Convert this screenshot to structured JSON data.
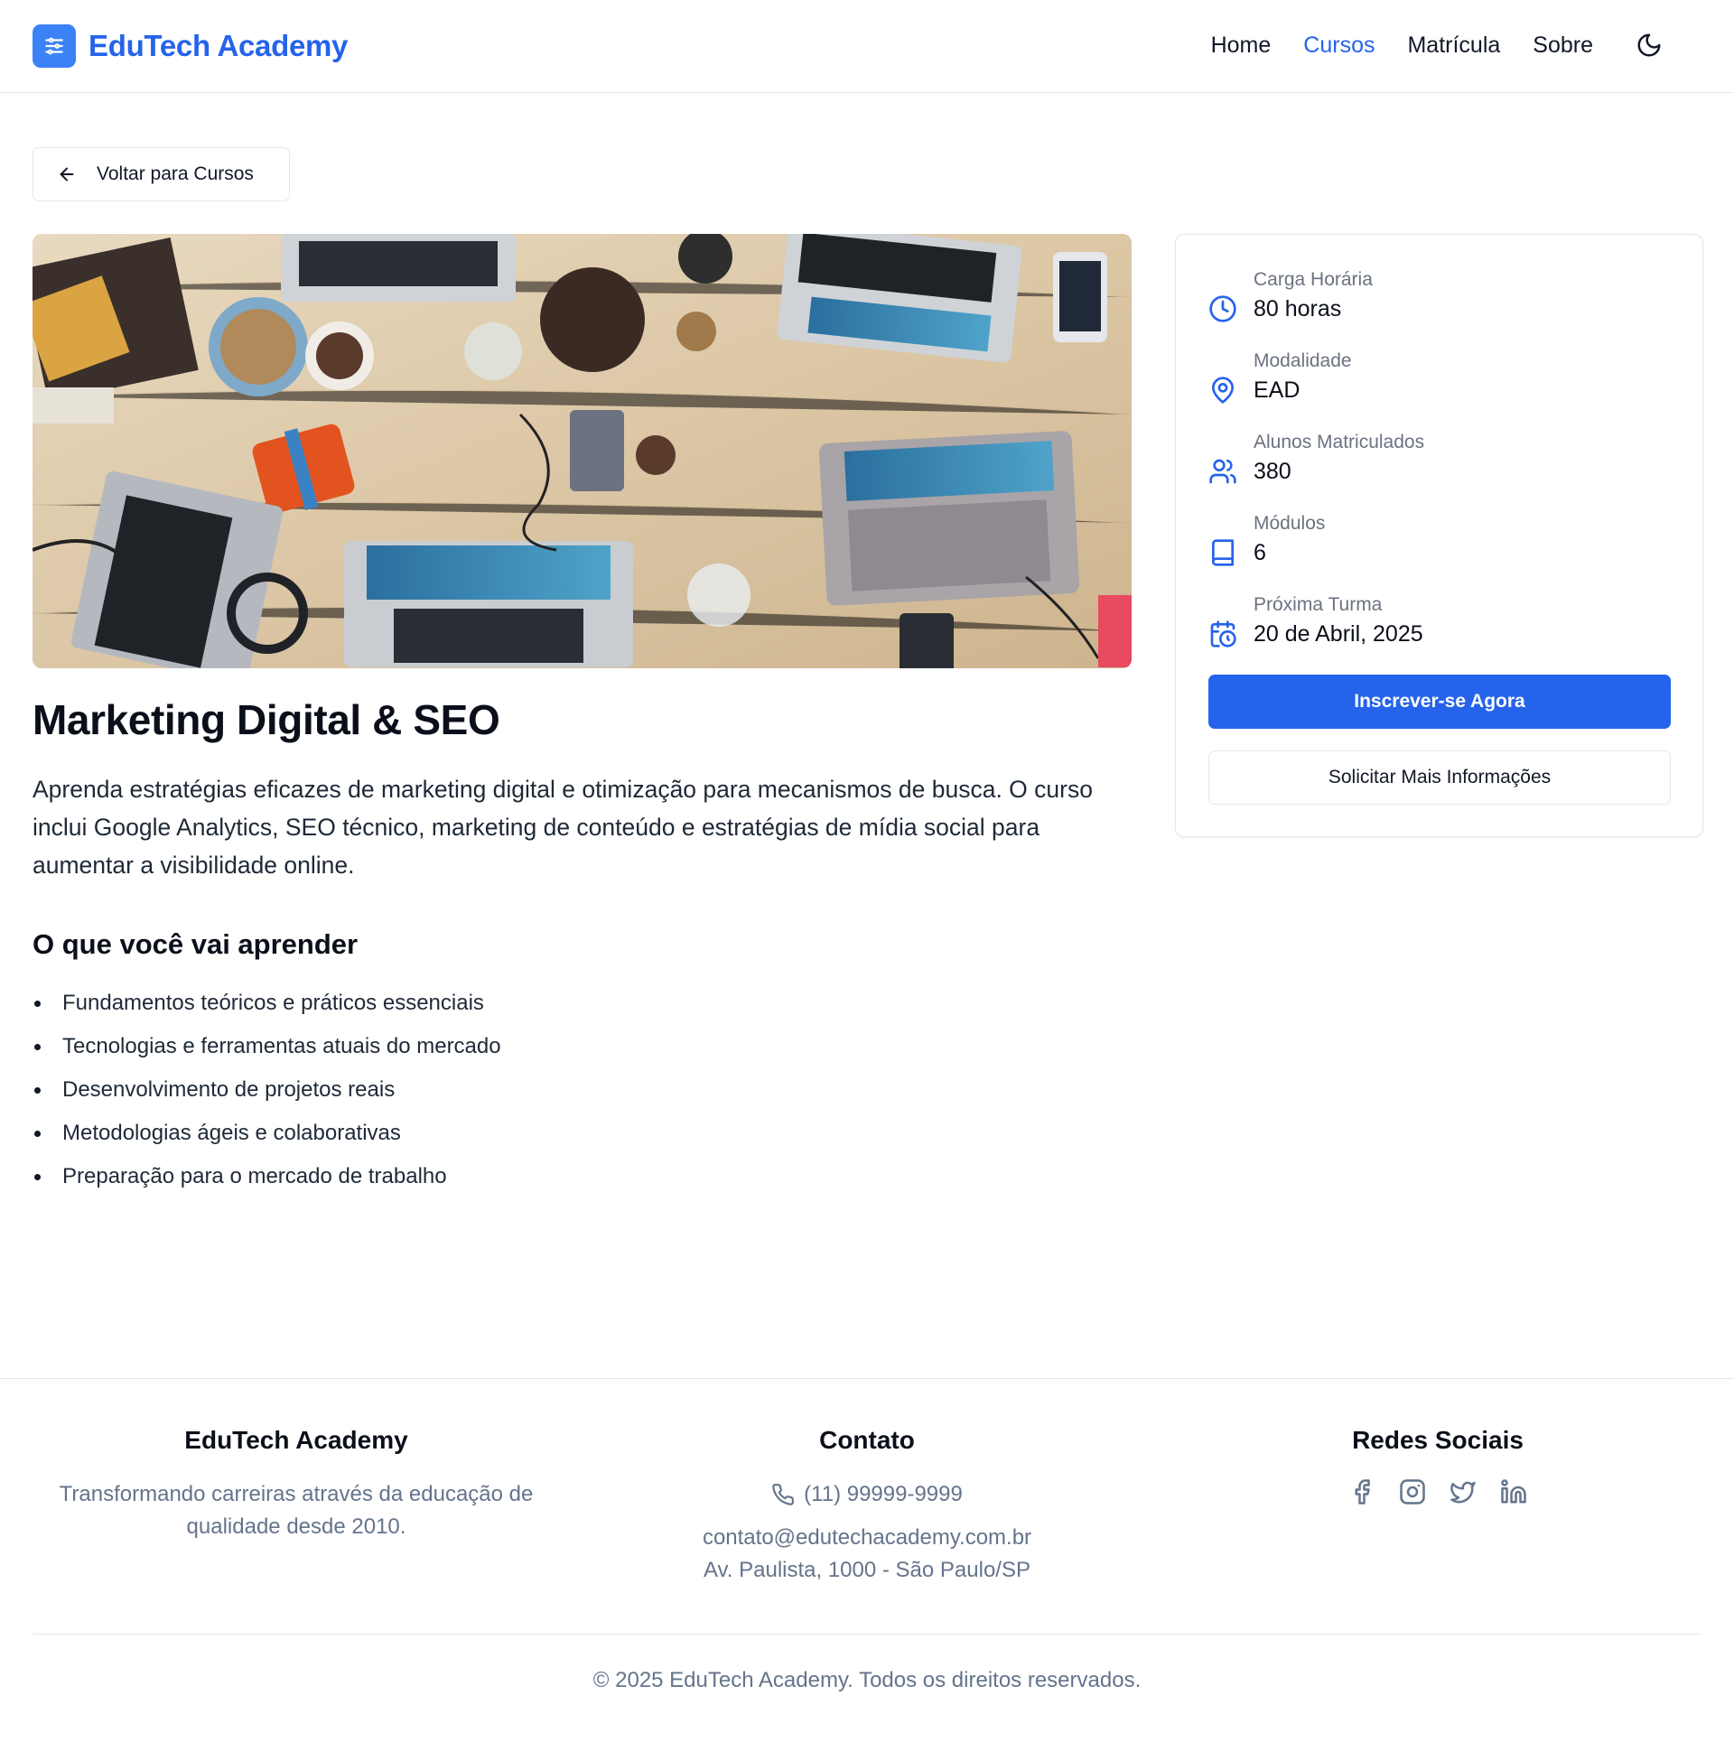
{
  "header": {
    "logo_text": "EduTech Academy",
    "nav": [
      "Home",
      "Cursos",
      "Matrícula",
      "Sobre"
    ],
    "active_nav": "Cursos"
  },
  "back_button": {
    "label": "Voltar para Cursos",
    "icon": "arrow-left-icon"
  },
  "course": {
    "title": "Marketing Digital & SEO",
    "description": "Aprenda estratégias eficazes de marketing digital e otimização para mecanismos de busca. O curso inclui Google Analytics, SEO técnico, marketing de conteúdo e estratégias de mídia social para aumentar a visibilidade online.",
    "learn_title": "O que você vai aprender",
    "learn_items": [
      "Fundamentos teóricos e práticos essenciais",
      "Tecnologias e ferramentas atuais do mercado",
      "Desenvolvimento de projetos reais",
      "Metodologias ágeis e colaborativas",
      "Preparação para o mercado de trabalho"
    ]
  },
  "sidebar": {
    "info": [
      {
        "label": "Carga Horária",
        "value": "80 horas",
        "icon": "clock-icon"
      },
      {
        "label": "Modalidade",
        "value": "EAD",
        "icon": "map-pin-icon"
      },
      {
        "label": "Alunos Matriculados",
        "value": "380",
        "icon": "users-icon"
      },
      {
        "label": "Módulos",
        "value": "6",
        "icon": "book-icon"
      },
      {
        "label": "Próxima Turma",
        "value": "20 de Abril, 2025",
        "icon": "calendar-clock-icon"
      }
    ],
    "primary_button": "Inscrever-se Agora",
    "secondary_button": "Solicitar Mais Informações"
  },
  "footer": {
    "about_title": "EduTech Academy",
    "about_text": "Transformando carreiras através da educação de qualidade desde 2010.",
    "contact_title": "Contato",
    "phone": "(11) 99999-9999",
    "email": "contato@edutechacademy.com.br",
    "address": "Av. Paulista, 1000 - São Paulo/SP",
    "social_title": "Redes Sociais",
    "social_icons": [
      "facebook-icon",
      "instagram-icon",
      "twitter-icon",
      "linkedin-icon"
    ],
    "copyright": "© 2025 EduTech Academy. Todos os direitos reservados."
  },
  "colors": {
    "accent": "#2563eb",
    "muted": "#64748b",
    "border": "#e5e7eb"
  }
}
